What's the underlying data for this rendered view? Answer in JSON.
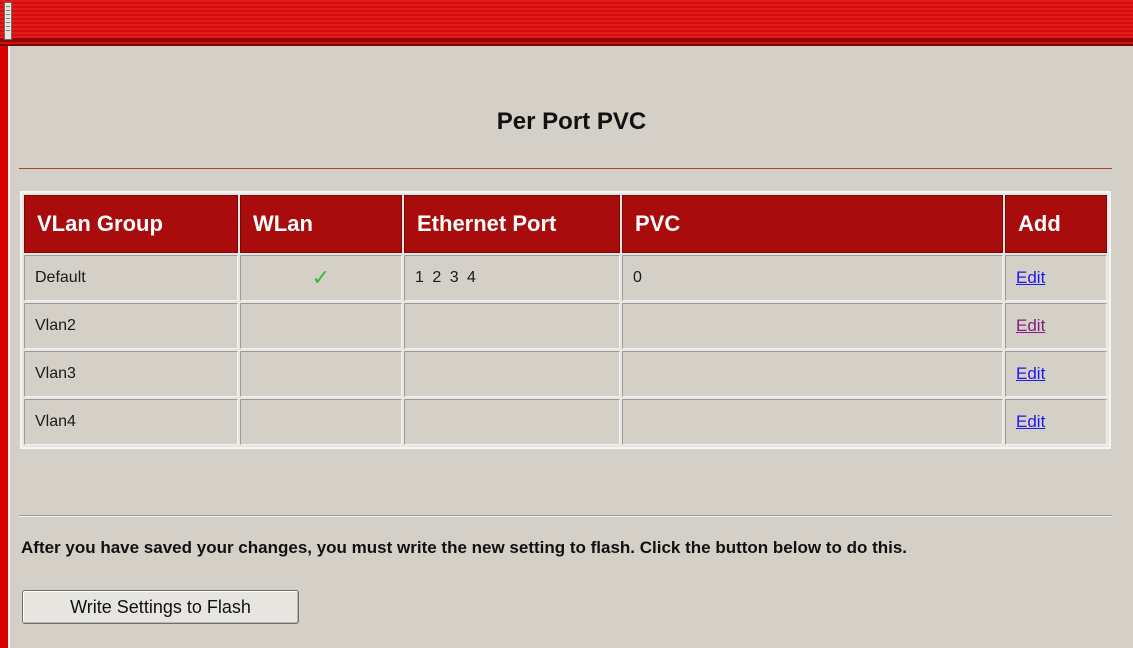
{
  "page": {
    "title": "Per Port PVC"
  },
  "table": {
    "headers": [
      "VLan Group",
      "WLan",
      "Ethernet Port",
      "PVC",
      "Add"
    ],
    "rows": [
      {
        "group": "Default",
        "wlan": "✓",
        "ports": "1 2 3 4",
        "pvc": "0",
        "action": "Edit"
      },
      {
        "group": "Vlan2",
        "wlan": "",
        "ports": "",
        "pvc": "",
        "action": "Edit"
      },
      {
        "group": "Vlan3",
        "wlan": "",
        "ports": "",
        "pvc": "",
        "action": "Edit"
      },
      {
        "group": "Vlan4",
        "wlan": "",
        "ports": "",
        "pvc": "",
        "action": "Edit"
      }
    ]
  },
  "flash": {
    "message": "After you have saved your changes, you must write the new setting to flash. Click the button below to do this.",
    "button_label": "Write Settings to Flash"
  },
  "colors": {
    "header_red": "#a80c0c",
    "panel_gray": "#d4d0c8",
    "link_blue": "#1a1aee",
    "link_visited": "#802080",
    "check_green": "#39b839"
  },
  "icons": {
    "wlan_enabled": "checkmark-icon",
    "doc_corner": "document-icon"
  }
}
